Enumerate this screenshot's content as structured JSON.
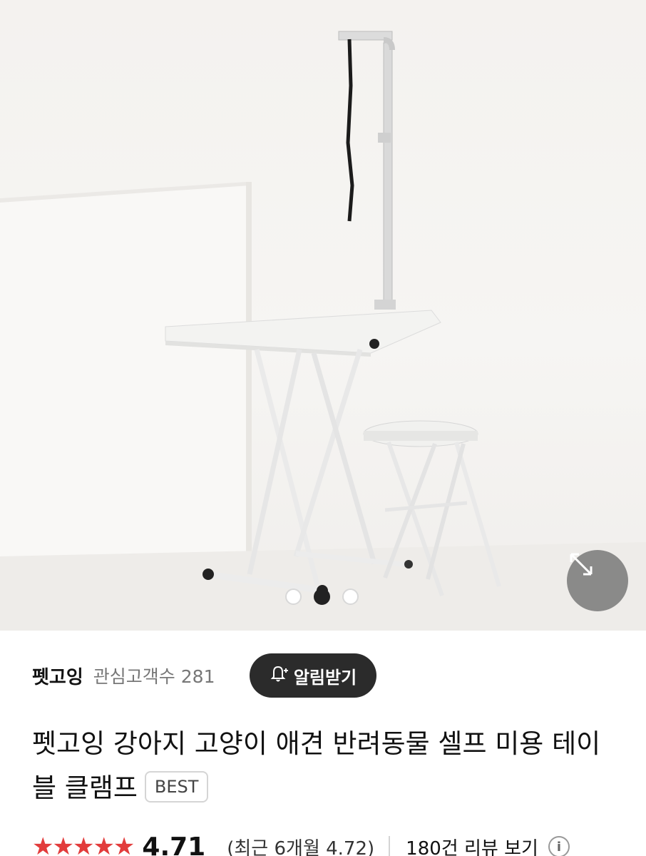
{
  "gallery": {
    "image_alt": "",
    "current_slide": 2,
    "total_slides": 3
  },
  "seller": {
    "name": "펫고잉",
    "followers_label": "관심고객수",
    "followers_count": "281",
    "notify_label": "알림받기"
  },
  "product": {
    "title": "펫고잉 강아지 고양이 애견 반려동물 셀프 미용 테이블 클램프",
    "badge": "BEST"
  },
  "rating": {
    "stars": "★★★★★",
    "score": "4.71",
    "recent_label": "(최근 6개월 4.72)",
    "review_link": "180건 리뷰 보기"
  },
  "colors": {
    "accent_star": "#e23c3c",
    "notify_bg": "#2b2b2b"
  }
}
